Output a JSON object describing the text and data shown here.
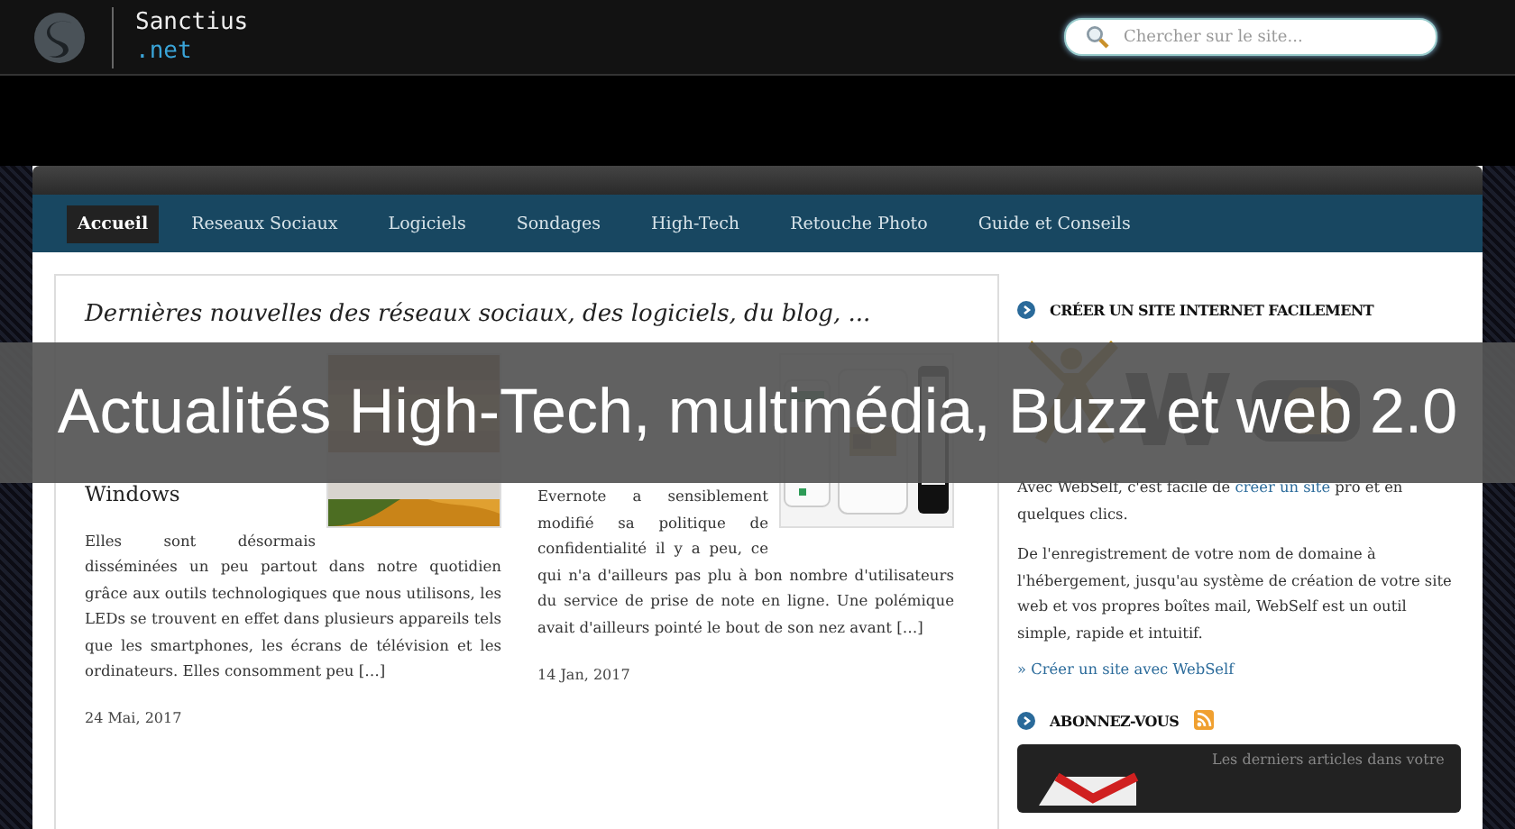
{
  "header": {
    "site_name": "Sanctius",
    "site_suffix": ".net",
    "search": {
      "placeholder": "Chercher sur le site..."
    }
  },
  "nav": [
    {
      "label": "Accueil",
      "selected": true
    },
    {
      "label": "Reseaux Sociaux",
      "selected": false
    },
    {
      "label": "Logiciels",
      "selected": false
    },
    {
      "label": "Sondages",
      "selected": false
    },
    {
      "label": "High-Tech",
      "selected": false
    },
    {
      "label": "Retouche Photo",
      "selected": false
    },
    {
      "label": "Guide et Conseils",
      "selected": false
    }
  ],
  "main": {
    "heading": "Dernières nouvelles des réseaux sociaux, des logiciels, du blog, ...",
    "articles": [
      {
        "title_tail": "Windows",
        "excerpt": "Elles sont désormais disséminées un peu partout dans notre quotidien grâce aux outils technologiques que nous utilisons, les LEDs se trouvent en effet dans plusieurs appareils tels que les smartphones, les écrans de télévision et les ordinateurs. Elles consomment peu […]",
        "date": "24 Mai, 2017"
      },
      {
        "excerpt": "Evernote a sensiblement modifié sa politique de confidentialité il y a peu, ce qui n'a d'ailleurs pas plu à bon nombre d'utilisateurs du service de prise de note en ligne. Une polémique avait d'ailleurs pointé le bout de son nez avant […]",
        "date": "14 Jan, 2017"
      }
    ]
  },
  "sidebar": {
    "sections": [
      {
        "heading": "CRÉER UN SITE INTERNET FACILEMENT",
        "intro": {
          "before": "Avec WebSelf, c'est facile de",
          "link": "créer un site",
          "after": "pro et en quelques clics."
        },
        "paragraphs": [
          "De l'enregistrement de votre nom de domaine à l'hébergement, jusqu'au système de création de votre site web et vos propres boîtes mail, WebSelf est un outil simple, rapide et intuitif."
        ],
        "link": "» Créer un site avec WebSelf"
      },
      {
        "heading": "ABONNEZ-VOUS",
        "rss": true,
        "promo": "Les derniers articles dans votre"
      }
    ]
  },
  "banner": {
    "text": "Actualités High-Tech, multimédia, Buzz et web 2.0"
  }
}
